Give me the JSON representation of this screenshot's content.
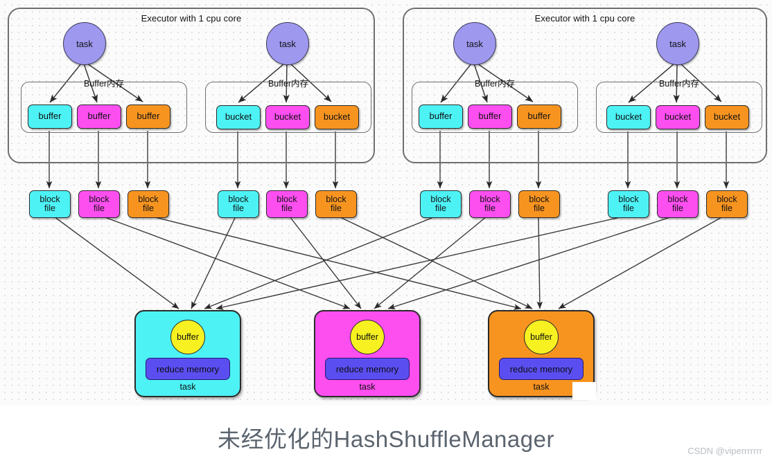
{
  "caption": "未经优化的HashShuffleManager",
  "watermark": "CSDN @viperrrrrrr",
  "colors": {
    "cyan": "#4df2f5",
    "magenta": "#fd4ef0",
    "orange": "#f79420",
    "task_purple": "#9e98ef",
    "buffer_yellow": "#f7f121",
    "reduce_memory_blue": "#5b4ef0",
    "container_border": "#6f6f6f",
    "caption_text": "#5b646e",
    "watermark_text": "#b9bec4",
    "background": "#fbfbfb"
  },
  "executors": [
    {
      "title": "Executor with 1 cpu core",
      "tasks": [
        {
          "label": "task",
          "buffer_group_label": "Buffer内存",
          "cells": [
            {
              "label": "buffer",
              "color": "cyan"
            },
            {
              "label": "buffer",
              "color": "magenta"
            },
            {
              "label": "buffer",
              "color": "orange"
            }
          ]
        },
        {
          "label": "task",
          "buffer_group_label": "Buffer内存",
          "cells": [
            {
              "label": "bucket",
              "color": "cyan"
            },
            {
              "label": "bucket",
              "color": "magenta"
            },
            {
              "label": "bucket",
              "color": "orange"
            }
          ]
        }
      ]
    },
    {
      "title": "Executor with 1 cpu core",
      "tasks": [
        {
          "label": "task",
          "buffer_group_label": "Buffer内存",
          "cells": [
            {
              "label": "buffer",
              "color": "cyan"
            },
            {
              "label": "buffer",
              "color": "magenta"
            },
            {
              "label": "buffer",
              "color": "orange"
            }
          ]
        },
        {
          "label": "task",
          "buffer_group_label": "Buffer内存",
          "cells": [
            {
              "label": "bucket",
              "color": "cyan"
            },
            {
              "label": "bucket",
              "color": "magenta"
            },
            {
              "label": "bucket",
              "color": "orange"
            }
          ]
        }
      ]
    }
  ],
  "block_files": [
    {
      "line1": "block",
      "line2": "file",
      "color": "cyan"
    },
    {
      "line1": "block",
      "line2": "file",
      "color": "magenta"
    },
    {
      "line1": "block",
      "line2": "file",
      "color": "orange"
    },
    {
      "line1": "block",
      "line2": "file",
      "color": "cyan"
    },
    {
      "line1": "block",
      "line2": "file",
      "color": "magenta"
    },
    {
      "line1": "block",
      "line2": "file",
      "color": "orange"
    },
    {
      "line1": "block",
      "line2": "file",
      "color": "cyan"
    },
    {
      "line1": "block",
      "line2": "file",
      "color": "magenta"
    },
    {
      "line1": "block",
      "line2": "file",
      "color": "orange"
    },
    {
      "line1": "block",
      "line2": "file",
      "color": "cyan"
    },
    {
      "line1": "block",
      "line2": "file",
      "color": "magenta"
    },
    {
      "line1": "block",
      "line2": "file",
      "color": "orange"
    }
  ],
  "reduce_tasks": [
    {
      "buffer_label": "buffer",
      "memory_label": "reduce memory",
      "task_label": "task",
      "color": "cyan"
    },
    {
      "buffer_label": "buffer",
      "memory_label": "reduce memory",
      "task_label": "task",
      "color": "magenta"
    },
    {
      "buffer_label": "buffer",
      "memory_label": "reduce memory",
      "task_label": "task",
      "color": "orange"
    }
  ]
}
